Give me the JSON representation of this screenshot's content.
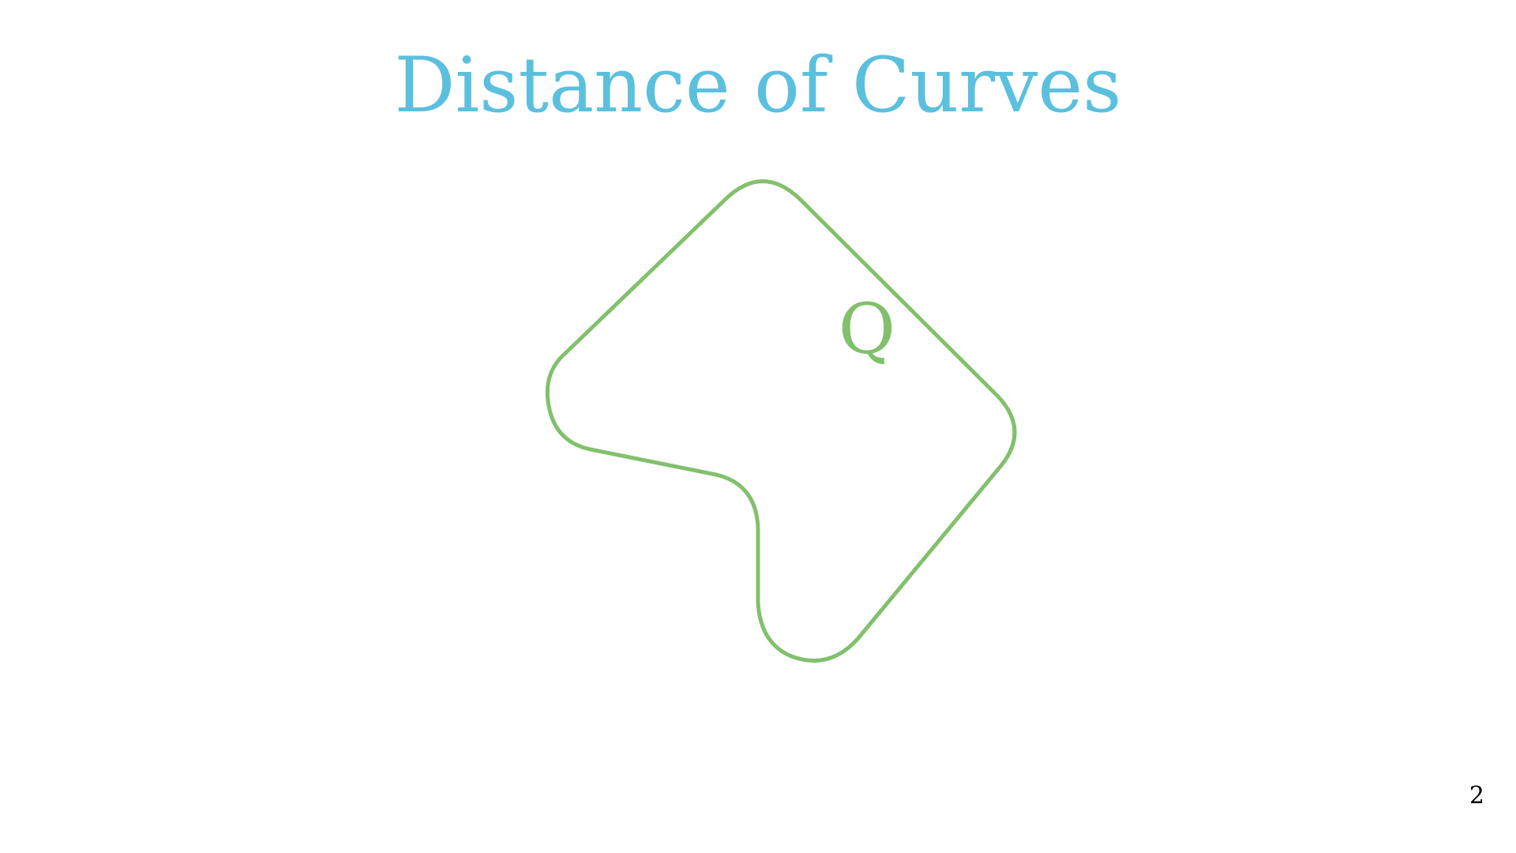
{
  "slide": {
    "title": "Distance of Curves",
    "page_number": "2"
  },
  "diagram": {
    "curve_label": "Q"
  },
  "colors": {
    "title": "#5bc0de",
    "curve": "#82c06c",
    "label": "#82c06c",
    "page_number": "#000000"
  }
}
